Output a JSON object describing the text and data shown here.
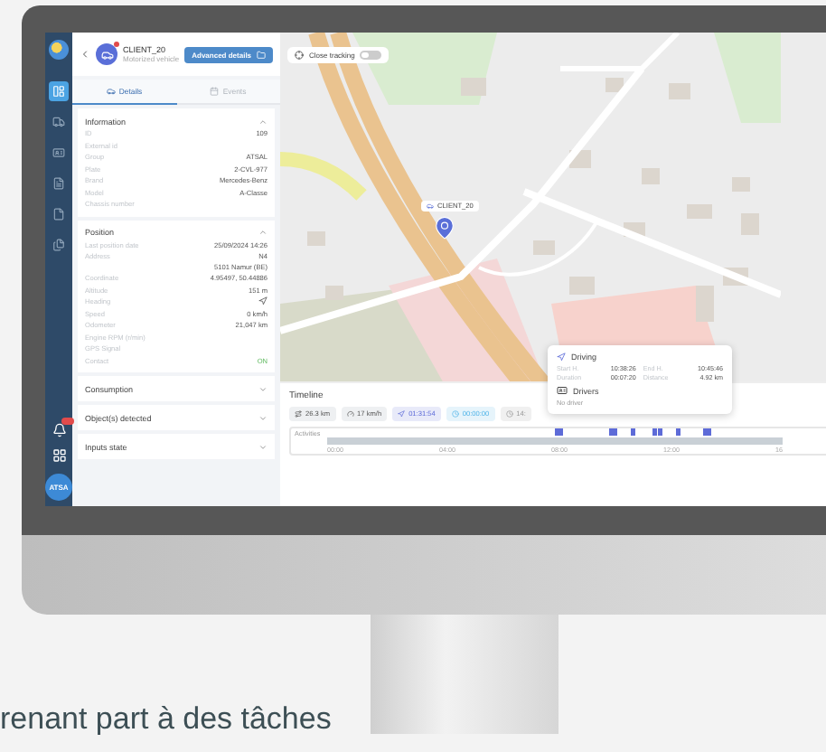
{
  "sidebar": {
    "nav": [
      {
        "selected": true
      },
      {
        "selected": false
      },
      {
        "selected": false
      },
      {
        "selected": false
      },
      {
        "selected": false
      },
      {
        "selected": false
      }
    ],
    "avatar": "ATSA"
  },
  "vehicle": {
    "name": "CLIENT_20",
    "type": "Motorized vehicle"
  },
  "advanced_button": "Advanced details",
  "tabs": [
    {
      "label": "Details",
      "selected": true
    },
    {
      "label": "Events",
      "selected": false
    }
  ],
  "sections": [
    {
      "title": "Information",
      "expanded": true,
      "rows": [
        {
          "label": "ID",
          "value": "109"
        },
        {
          "label": "External id",
          "value": ""
        },
        {
          "label": "Group",
          "value": "ATSAL"
        },
        {
          "label": "Plate",
          "value": "2-CVL-977"
        },
        {
          "label": "Brand",
          "value": "Mercedes-Benz"
        },
        {
          "label": "Model",
          "value": "A-Classe"
        },
        {
          "label": "Chassis number",
          "value": ""
        }
      ]
    },
    {
      "title": "Position",
      "expanded": true,
      "rows": [
        {
          "label": "Last position date",
          "value": "25/09/2024 14:26"
        },
        {
          "label": "Address",
          "value": "N4\n5101 Namur (BE)"
        },
        {
          "label": "Coordinate",
          "value": "4.95497, 50.44886"
        },
        {
          "label": "Altitude",
          "value": "151 m"
        },
        {
          "label": "Heading",
          "kind": "heading"
        },
        {
          "label": "Speed",
          "value": "0 km/h"
        },
        {
          "label": "Odometer",
          "value": "21,047 km"
        },
        {
          "label": "Engine RPM (r/min)",
          "value": ""
        },
        {
          "label": "GPS Signal",
          "value": ""
        },
        {
          "label": "Contact",
          "value": "ON",
          "kind": "status"
        }
      ]
    },
    {
      "title": "Consumption",
      "expanded": false
    },
    {
      "title": "Object(s) detected",
      "expanded": false
    },
    {
      "title": "Inputs state",
      "expanded": false
    }
  ],
  "map": {
    "tracking": {
      "label": "Close tracking",
      "on": false
    },
    "marker": {
      "label": "CLIENT_20"
    }
  },
  "popup": {
    "title": "Driving",
    "fields": [
      {
        "label": "Start H.",
        "value": "10:38:26"
      },
      {
        "label": "End H.",
        "value": "10:45:46"
      },
      {
        "label": "Duration",
        "value": "00:07:20"
      },
      {
        "label": "Distance",
        "value": "4.92 km"
      }
    ],
    "drivers_title": "Drivers",
    "drivers_text": "No driver"
  },
  "timeline": {
    "title": "Timeline",
    "chips": [
      {
        "kind": "distance",
        "text": "26.3 km"
      },
      {
        "kind": "speed",
        "text": "17 km/h"
      },
      {
        "kind": "driving",
        "text": "01:31:54"
      },
      {
        "kind": "idle",
        "text": "00:00:00"
      },
      {
        "kind": "stop",
        "text": "14:"
      }
    ],
    "row_label": "Activities",
    "ticks": [
      "00:00",
      "04:00",
      "08:00",
      "12:00",
      "16"
    ]
  },
  "caption": "renant part à des tâches"
}
